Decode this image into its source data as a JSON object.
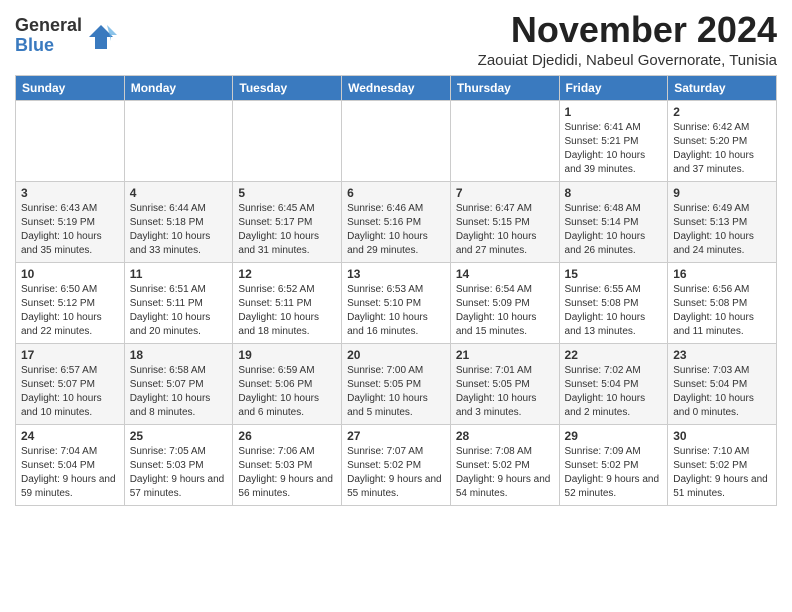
{
  "logo": {
    "text_general": "General",
    "text_blue": "Blue"
  },
  "header": {
    "month_year": "November 2024",
    "location": "Zaouiat Djedidi, Nabeul Governorate, Tunisia"
  },
  "days_of_week": [
    "Sunday",
    "Monday",
    "Tuesday",
    "Wednesday",
    "Thursday",
    "Friday",
    "Saturday"
  ],
  "weeks": [
    [
      {
        "day": "",
        "info": ""
      },
      {
        "day": "",
        "info": ""
      },
      {
        "day": "",
        "info": ""
      },
      {
        "day": "",
        "info": ""
      },
      {
        "day": "",
        "info": ""
      },
      {
        "day": "1",
        "info": "Sunrise: 6:41 AM\nSunset: 5:21 PM\nDaylight: 10 hours and 39 minutes."
      },
      {
        "day": "2",
        "info": "Sunrise: 6:42 AM\nSunset: 5:20 PM\nDaylight: 10 hours and 37 minutes."
      }
    ],
    [
      {
        "day": "3",
        "info": "Sunrise: 6:43 AM\nSunset: 5:19 PM\nDaylight: 10 hours and 35 minutes."
      },
      {
        "day": "4",
        "info": "Sunrise: 6:44 AM\nSunset: 5:18 PM\nDaylight: 10 hours and 33 minutes."
      },
      {
        "day": "5",
        "info": "Sunrise: 6:45 AM\nSunset: 5:17 PM\nDaylight: 10 hours and 31 minutes."
      },
      {
        "day": "6",
        "info": "Sunrise: 6:46 AM\nSunset: 5:16 PM\nDaylight: 10 hours and 29 minutes."
      },
      {
        "day": "7",
        "info": "Sunrise: 6:47 AM\nSunset: 5:15 PM\nDaylight: 10 hours and 27 minutes."
      },
      {
        "day": "8",
        "info": "Sunrise: 6:48 AM\nSunset: 5:14 PM\nDaylight: 10 hours and 26 minutes."
      },
      {
        "day": "9",
        "info": "Sunrise: 6:49 AM\nSunset: 5:13 PM\nDaylight: 10 hours and 24 minutes."
      }
    ],
    [
      {
        "day": "10",
        "info": "Sunrise: 6:50 AM\nSunset: 5:12 PM\nDaylight: 10 hours and 22 minutes."
      },
      {
        "day": "11",
        "info": "Sunrise: 6:51 AM\nSunset: 5:11 PM\nDaylight: 10 hours and 20 minutes."
      },
      {
        "day": "12",
        "info": "Sunrise: 6:52 AM\nSunset: 5:11 PM\nDaylight: 10 hours and 18 minutes."
      },
      {
        "day": "13",
        "info": "Sunrise: 6:53 AM\nSunset: 5:10 PM\nDaylight: 10 hours and 16 minutes."
      },
      {
        "day": "14",
        "info": "Sunrise: 6:54 AM\nSunset: 5:09 PM\nDaylight: 10 hours and 15 minutes."
      },
      {
        "day": "15",
        "info": "Sunrise: 6:55 AM\nSunset: 5:08 PM\nDaylight: 10 hours and 13 minutes."
      },
      {
        "day": "16",
        "info": "Sunrise: 6:56 AM\nSunset: 5:08 PM\nDaylight: 10 hours and 11 minutes."
      }
    ],
    [
      {
        "day": "17",
        "info": "Sunrise: 6:57 AM\nSunset: 5:07 PM\nDaylight: 10 hours and 10 minutes."
      },
      {
        "day": "18",
        "info": "Sunrise: 6:58 AM\nSunset: 5:07 PM\nDaylight: 10 hours and 8 minutes."
      },
      {
        "day": "19",
        "info": "Sunrise: 6:59 AM\nSunset: 5:06 PM\nDaylight: 10 hours and 6 minutes."
      },
      {
        "day": "20",
        "info": "Sunrise: 7:00 AM\nSunset: 5:05 PM\nDaylight: 10 hours and 5 minutes."
      },
      {
        "day": "21",
        "info": "Sunrise: 7:01 AM\nSunset: 5:05 PM\nDaylight: 10 hours and 3 minutes."
      },
      {
        "day": "22",
        "info": "Sunrise: 7:02 AM\nSunset: 5:04 PM\nDaylight: 10 hours and 2 minutes."
      },
      {
        "day": "23",
        "info": "Sunrise: 7:03 AM\nSunset: 5:04 PM\nDaylight: 10 hours and 0 minutes."
      }
    ],
    [
      {
        "day": "24",
        "info": "Sunrise: 7:04 AM\nSunset: 5:04 PM\nDaylight: 9 hours and 59 minutes."
      },
      {
        "day": "25",
        "info": "Sunrise: 7:05 AM\nSunset: 5:03 PM\nDaylight: 9 hours and 57 minutes."
      },
      {
        "day": "26",
        "info": "Sunrise: 7:06 AM\nSunset: 5:03 PM\nDaylight: 9 hours and 56 minutes."
      },
      {
        "day": "27",
        "info": "Sunrise: 7:07 AM\nSunset: 5:02 PM\nDaylight: 9 hours and 55 minutes."
      },
      {
        "day": "28",
        "info": "Sunrise: 7:08 AM\nSunset: 5:02 PM\nDaylight: 9 hours and 54 minutes."
      },
      {
        "day": "29",
        "info": "Sunrise: 7:09 AM\nSunset: 5:02 PM\nDaylight: 9 hours and 52 minutes."
      },
      {
        "day": "30",
        "info": "Sunrise: 7:10 AM\nSunset: 5:02 PM\nDaylight: 9 hours and 51 minutes."
      }
    ]
  ]
}
